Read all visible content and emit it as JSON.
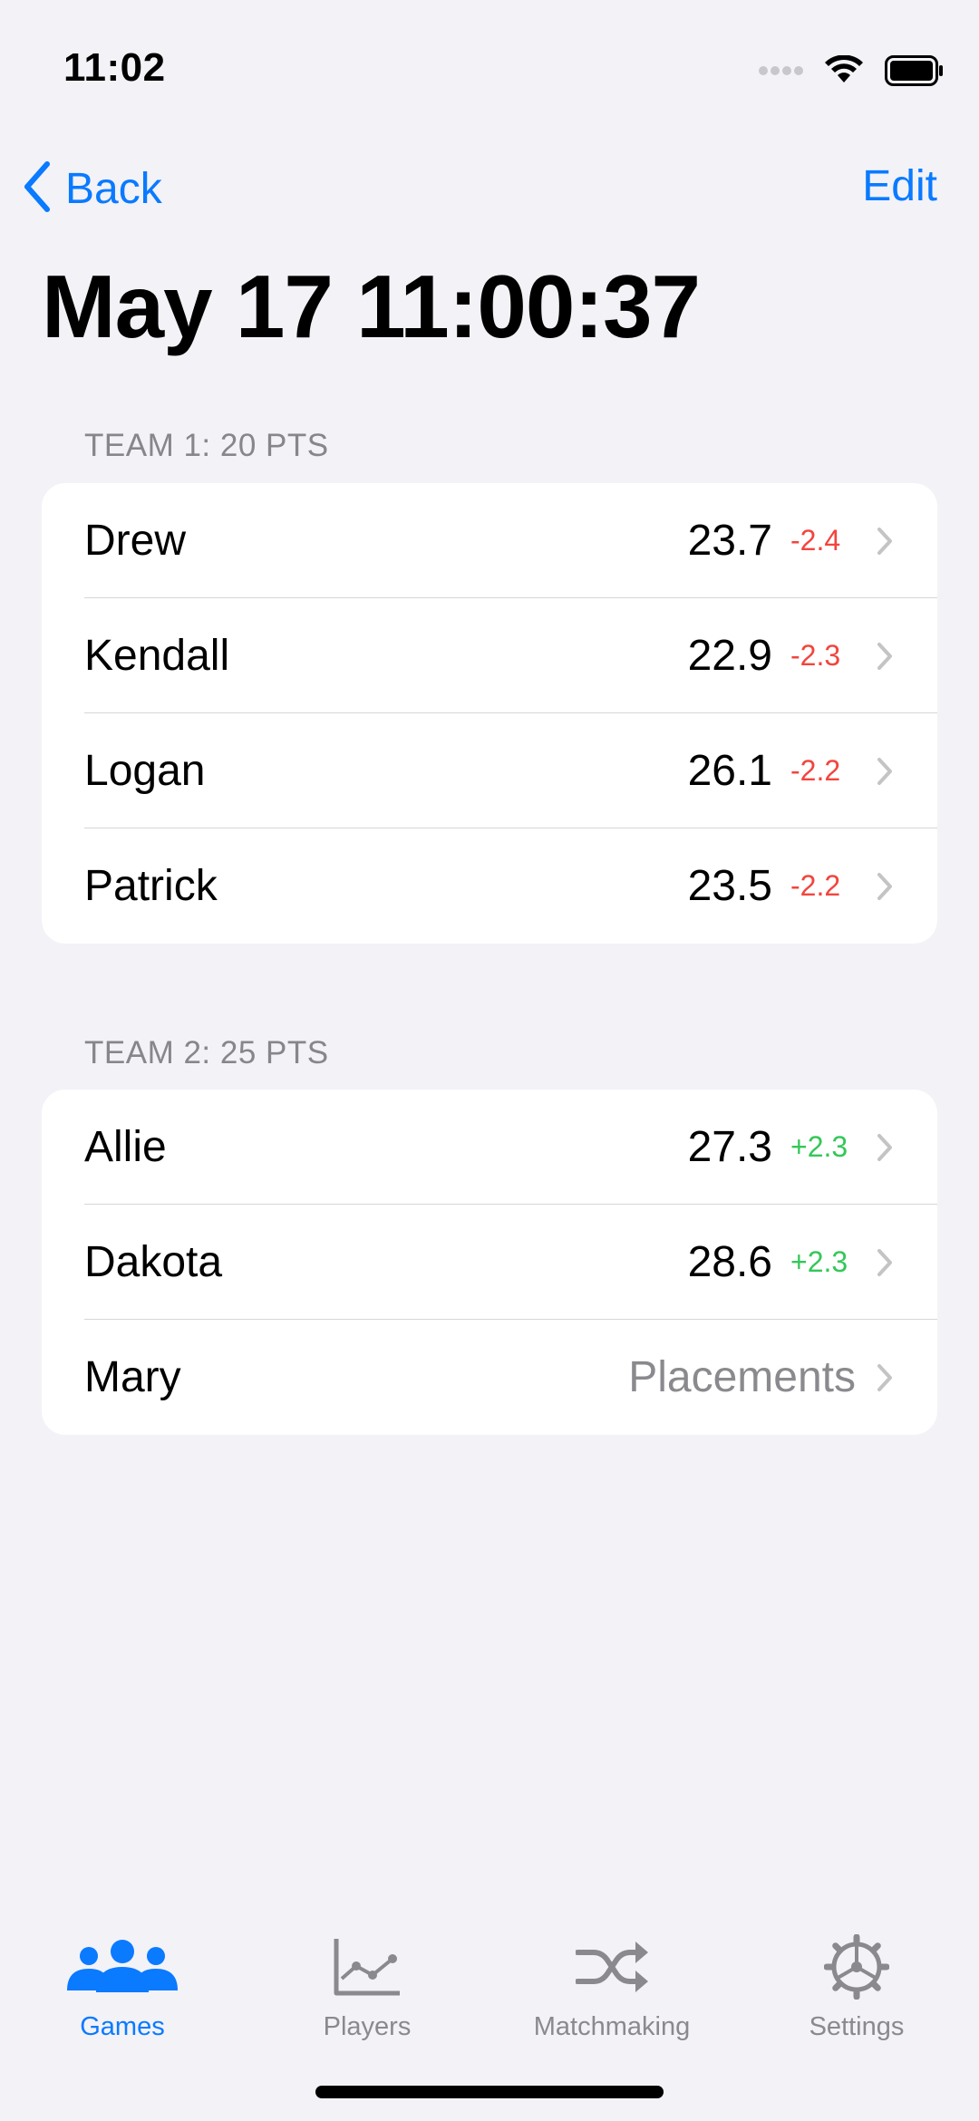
{
  "status_bar": {
    "time": "11:02"
  },
  "nav": {
    "back_label": "Back",
    "edit_label": "Edit",
    "title": "May 17 11:00:37"
  },
  "team1": {
    "header": "TEAM 1: 20 PTS",
    "players": [
      {
        "name": "Drew",
        "rating": "23.7",
        "delta": "-2.4"
      },
      {
        "name": "Kendall",
        "rating": "22.9",
        "delta": "-2.3"
      },
      {
        "name": "Logan",
        "rating": "26.1",
        "delta": "-2.2"
      },
      {
        "name": "Patrick",
        "rating": "23.5",
        "delta": "-2.2"
      }
    ]
  },
  "team2": {
    "header": "TEAM 2: 25 PTS",
    "players": [
      {
        "name": "Allie",
        "rating": "27.3",
        "delta": "+2.3"
      },
      {
        "name": "Dakota",
        "rating": "28.6",
        "delta": "+2.3"
      },
      {
        "name": "Mary",
        "status": "Placements"
      }
    ]
  },
  "tabs": [
    {
      "label": "Games",
      "icon": "people-icon",
      "active": true
    },
    {
      "label": "Players",
      "icon": "chart-line-icon",
      "active": false
    },
    {
      "label": "Matchmaking",
      "icon": "shuffle-icon",
      "active": false
    },
    {
      "label": "Settings",
      "icon": "gear-icon",
      "active": false
    }
  ],
  "colors": {
    "accent": "#0a7aff",
    "negative": "#f2453d",
    "positive": "#34c759",
    "background": "#f2f2f7",
    "secondary_text": "#8a8a8e"
  }
}
